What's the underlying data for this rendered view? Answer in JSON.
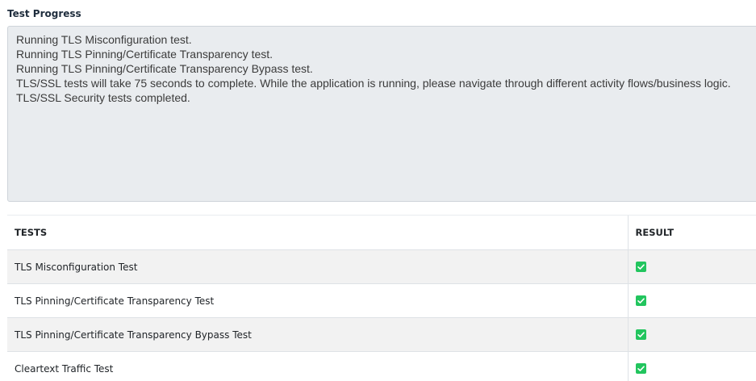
{
  "section_title": "Test Progress",
  "log_lines": [
    "Running TLS Misconfiguration test.",
    "Running TLS Pinning/Certificate Transparency test.",
    "Running TLS Pinning/Certificate Transparency Bypass test.",
    "TLS/SSL tests will take 75 seconds to complete. While the application is running, please navigate through different activity flows/business logic.",
    "TLS/SSL Security tests completed."
  ],
  "table": {
    "headers": {
      "tests": "TESTS",
      "result": "RESULT"
    },
    "rows": [
      {
        "test": "TLS Misconfiguration Test",
        "result": "passed",
        "icon": "check-icon"
      },
      {
        "test": "TLS Pinning/Certificate Transparency Test",
        "result": "passed",
        "icon": "check-icon"
      },
      {
        "test": "TLS Pinning/Certificate Transparency Bypass Test",
        "result": "passed",
        "icon": "check-icon"
      },
      {
        "test": "Cleartext Traffic Test",
        "result": "passed",
        "icon": "check-icon"
      }
    ]
  },
  "colors": {
    "check_bg": "#22c55e",
    "log_bg": "#e9ecef"
  }
}
